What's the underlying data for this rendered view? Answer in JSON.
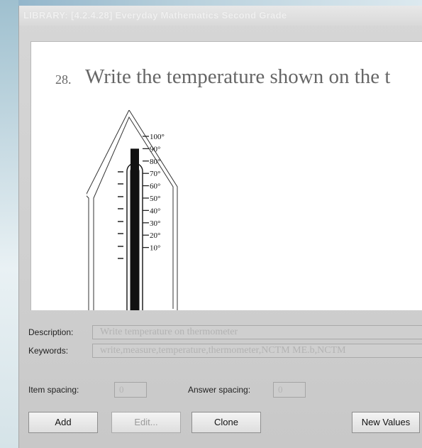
{
  "window": {
    "title": "LIBRARY: [4.2.4.28] Everyday Mathematics Second Grade"
  },
  "preview": {
    "question_number": "28.",
    "question_text": "Write the temperature shown on the t",
    "thermometer": {
      "scale_labels": [
        "100°",
        "90°",
        "80°",
        "70°",
        "60°",
        "50°",
        "40°",
        "30°",
        "20°",
        "10°"
      ],
      "mercury_reading": 90
    }
  },
  "form": {
    "description_label": "Description:",
    "description_value": "Write temperature on thermometer",
    "keywords_label": "Keywords:",
    "keywords_value": "write,measure,temperature,thermometer,NCTM ME.b,NCTM",
    "item_spacing_label": "Item spacing:",
    "item_spacing_value": "0",
    "answer_spacing_label": "Answer spacing:",
    "answer_spacing_value": "0"
  },
  "buttons": {
    "add": "Add",
    "edit": "Edit...",
    "clone": "Clone",
    "new_values": "New Values"
  }
}
